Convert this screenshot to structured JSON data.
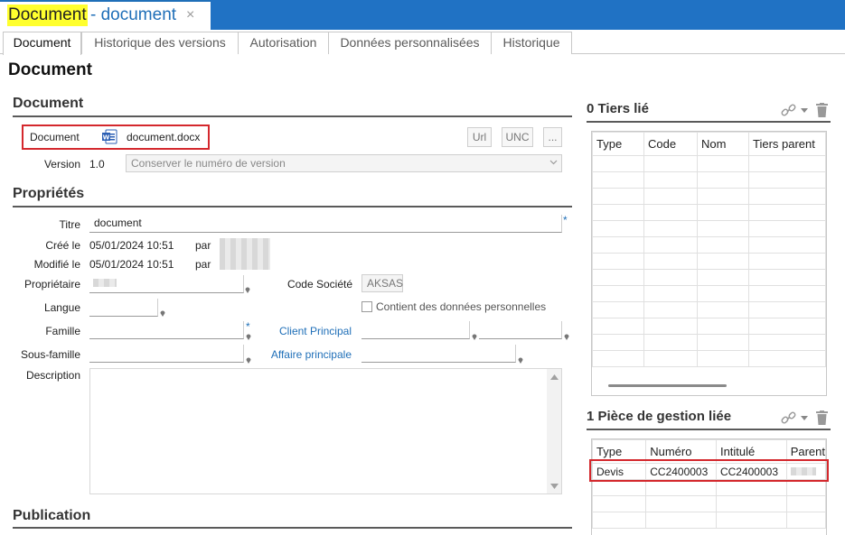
{
  "titlebar": {
    "title": "Document",
    "subtitle": "- document",
    "close_glyph": "×"
  },
  "tabs": [
    {
      "label": "Document",
      "active": true
    },
    {
      "label": "Historique des versions"
    },
    {
      "label": "Autorisation"
    },
    {
      "label": "Données personnalisées"
    },
    {
      "label": "Historique"
    }
  ],
  "page_title": "Document",
  "sections": {
    "document": "Document",
    "proprietes": "Propriétés",
    "publication": "Publication"
  },
  "doc_section": {
    "document_label": "Document",
    "file_name": "document.docx",
    "file_icon": "word-file-icon",
    "btn_url": "Url",
    "btn_unc": "UNC",
    "btn_more": "...",
    "version_label": "Version",
    "version_value": "1.0",
    "version_option": "Conserver le numéro de version"
  },
  "props": {
    "titre_label": "Titre",
    "titre_value": "document",
    "required_mark": "*",
    "cree_label": "Créé le",
    "cree_value": "05/01/2024 10:51",
    "par_label": "par",
    "modifie_label": "Modifié le",
    "modifie_value": "05/01/2024 10:51",
    "proprietaire_label": "Propriétaire",
    "code_societe_label": "Code Société",
    "code_societe_value": "AKSAS",
    "langue_label": "Langue",
    "donnees_perso_label": "Contient des données personnelles",
    "famille_label": "Famille",
    "client_principal_label": "Client Principal",
    "sous_famille_label": "Sous-famille",
    "affaire_principale_label": "Affaire principale",
    "description_label": "Description"
  },
  "tiers_panel": {
    "title": "0 Tiers lié",
    "columns": [
      "Type",
      "Code",
      "Nom",
      "Tiers parent"
    ]
  },
  "gestion_panel": {
    "title": "1 Pièce de gestion liée",
    "columns": [
      "Type",
      "Numéro",
      "Intitulé",
      "Parent"
    ],
    "rows": [
      {
        "type": "Devis",
        "numero": "CC2400003",
        "intitule": "CC2400003"
      }
    ]
  },
  "icons": {
    "link": "link-icon",
    "trash": "trash-icon",
    "pin": "pin-icon"
  },
  "colors": {
    "accent": "#2072c4",
    "highlight": "#ffff2e",
    "red_box": "#d4282d",
    "link": "#1f6fb8"
  }
}
